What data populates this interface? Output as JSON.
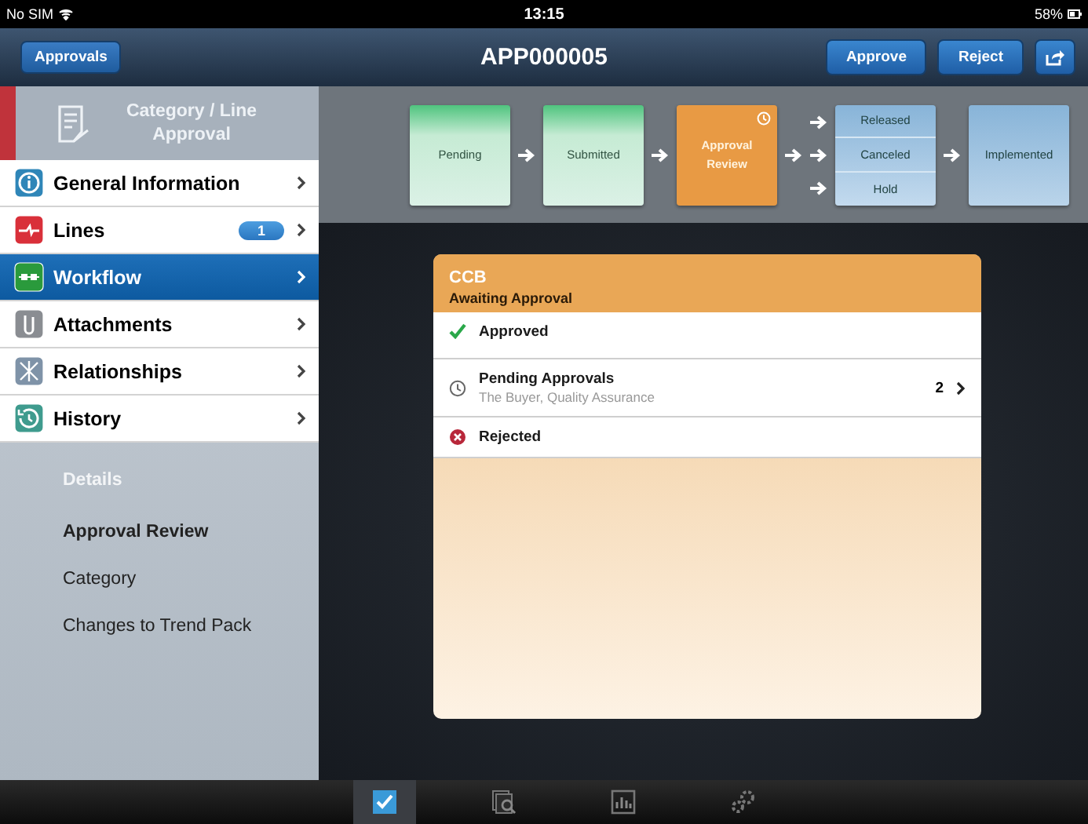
{
  "status_bar": {
    "carrier": "No SIM",
    "time": "13:15",
    "battery": "58%"
  },
  "nav_bar": {
    "back": "Approvals",
    "title": "APP000005",
    "actions": [
      "Approve",
      "Reject"
    ]
  },
  "sidebar": {
    "header": "Category / Line Approval",
    "items": [
      {
        "label": "General Information",
        "kind": "info",
        "selected": false
      },
      {
        "label": "Lines",
        "kind": "lines",
        "badge": "1",
        "selected": false
      },
      {
        "label": "Workflow",
        "kind": "workflow",
        "selected": true
      },
      {
        "label": "Attachments",
        "kind": "attachments",
        "selected": false
      },
      {
        "label": "Relationships",
        "kind": "relationships",
        "selected": false
      },
      {
        "label": "History",
        "kind": "history",
        "selected": false
      }
    ],
    "details": {
      "title": "Details",
      "items": [
        {
          "label": "Approval Review",
          "selected": true
        },
        {
          "label": "Category",
          "selected": false
        },
        {
          "label": "Changes to Trend Pack",
          "selected": false
        }
      ]
    }
  },
  "workflow": [
    {
      "kind": "single",
      "done": true,
      "current": false,
      "label": "Pending"
    },
    {
      "kind": "single",
      "done": true,
      "current": false,
      "label": "Submitted"
    },
    {
      "kind": "single",
      "done": false,
      "current": true,
      "label": "Approval Review"
    },
    {
      "kind": "group",
      "done": false,
      "current": false,
      "options": [
        "Released",
        "Canceled",
        "Hold"
      ]
    },
    {
      "kind": "single",
      "done": false,
      "current": false,
      "label": "Implemented"
    }
  ],
  "card": {
    "title": "CCB",
    "subtitle": "Awaiting Approval",
    "rows": [
      {
        "kind": "approved",
        "label": "Approved"
      },
      {
        "kind": "pending",
        "label": "Pending Approvals",
        "detail": "The Buyer, Quality Assurance",
        "count": "2"
      },
      {
        "kind": "rejected",
        "label": "Rejected"
      }
    ]
  },
  "tab_bar": [
    {
      "kind": "approvals",
      "selected": true
    },
    {
      "kind": "queries",
      "selected": false
    },
    {
      "kind": "analytics",
      "selected": false
    },
    {
      "kind": "settings",
      "selected": false
    }
  ]
}
